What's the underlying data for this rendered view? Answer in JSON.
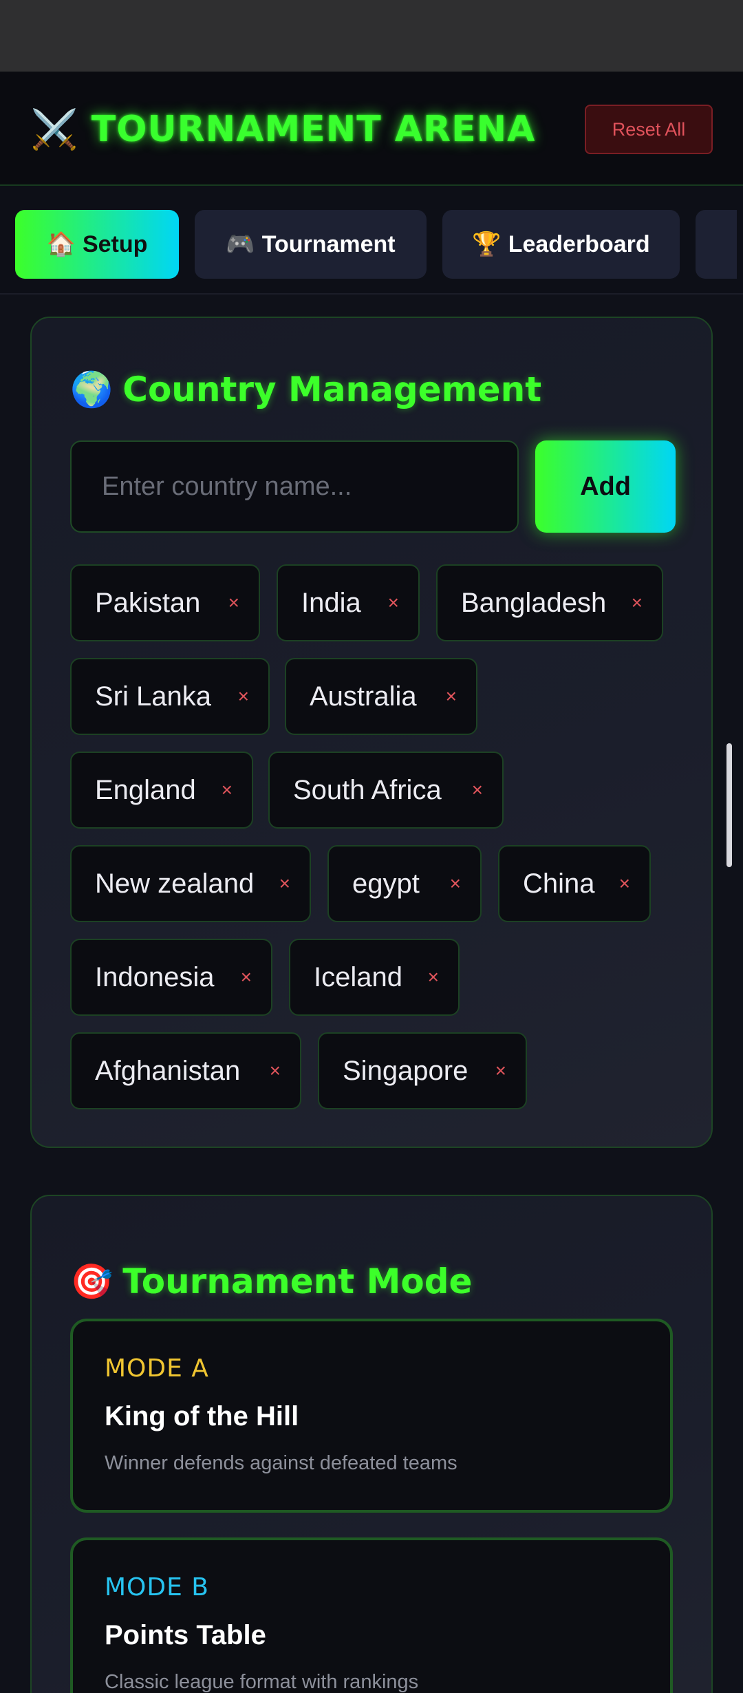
{
  "app": {
    "title": "TOURNAMENT ARENA",
    "title_icon": "⚔️",
    "title_icon_name": "crossed-swords-icon",
    "reset_label": "Reset All",
    "accent_color": "#39ff2e",
    "accent_secondary": "#00d6f5"
  },
  "tabs": [
    {
      "icon": "🏠",
      "icon_name": "house-icon",
      "label": "Setup",
      "active": true
    },
    {
      "icon": "🎮",
      "icon_name": "gamepad-icon",
      "label": "Tournament",
      "active": false
    },
    {
      "icon": "🏆",
      "icon_name": "trophy-icon",
      "label": "Leaderboard",
      "active": false
    }
  ],
  "country_management": {
    "title": "Country Management",
    "title_icon": "🌍",
    "input_placeholder": "Enter country name...",
    "input_value": "",
    "add_label": "Add",
    "remove_symbol": "×",
    "countries": [
      "Pakistan",
      "India",
      "Bangladesh",
      "Sri Lanka",
      "Australia",
      "England",
      "South Africa",
      "New zealand",
      "egypt",
      "China",
      "Indonesia",
      "Iceland",
      "Afghanistan",
      "Singapore"
    ]
  },
  "tournament_mode": {
    "title": "Tournament Mode",
    "title_icon": "🎯",
    "modes": [
      {
        "tag": "MODE A",
        "name": "King of the Hill",
        "description": "Winner defends against defeated teams",
        "tag_color": "#f0c531"
      },
      {
        "tag": "MODE B",
        "name": "Points Table",
        "description": "Classic league format with rankings",
        "tag_color": "#27c3f0"
      }
    ]
  }
}
